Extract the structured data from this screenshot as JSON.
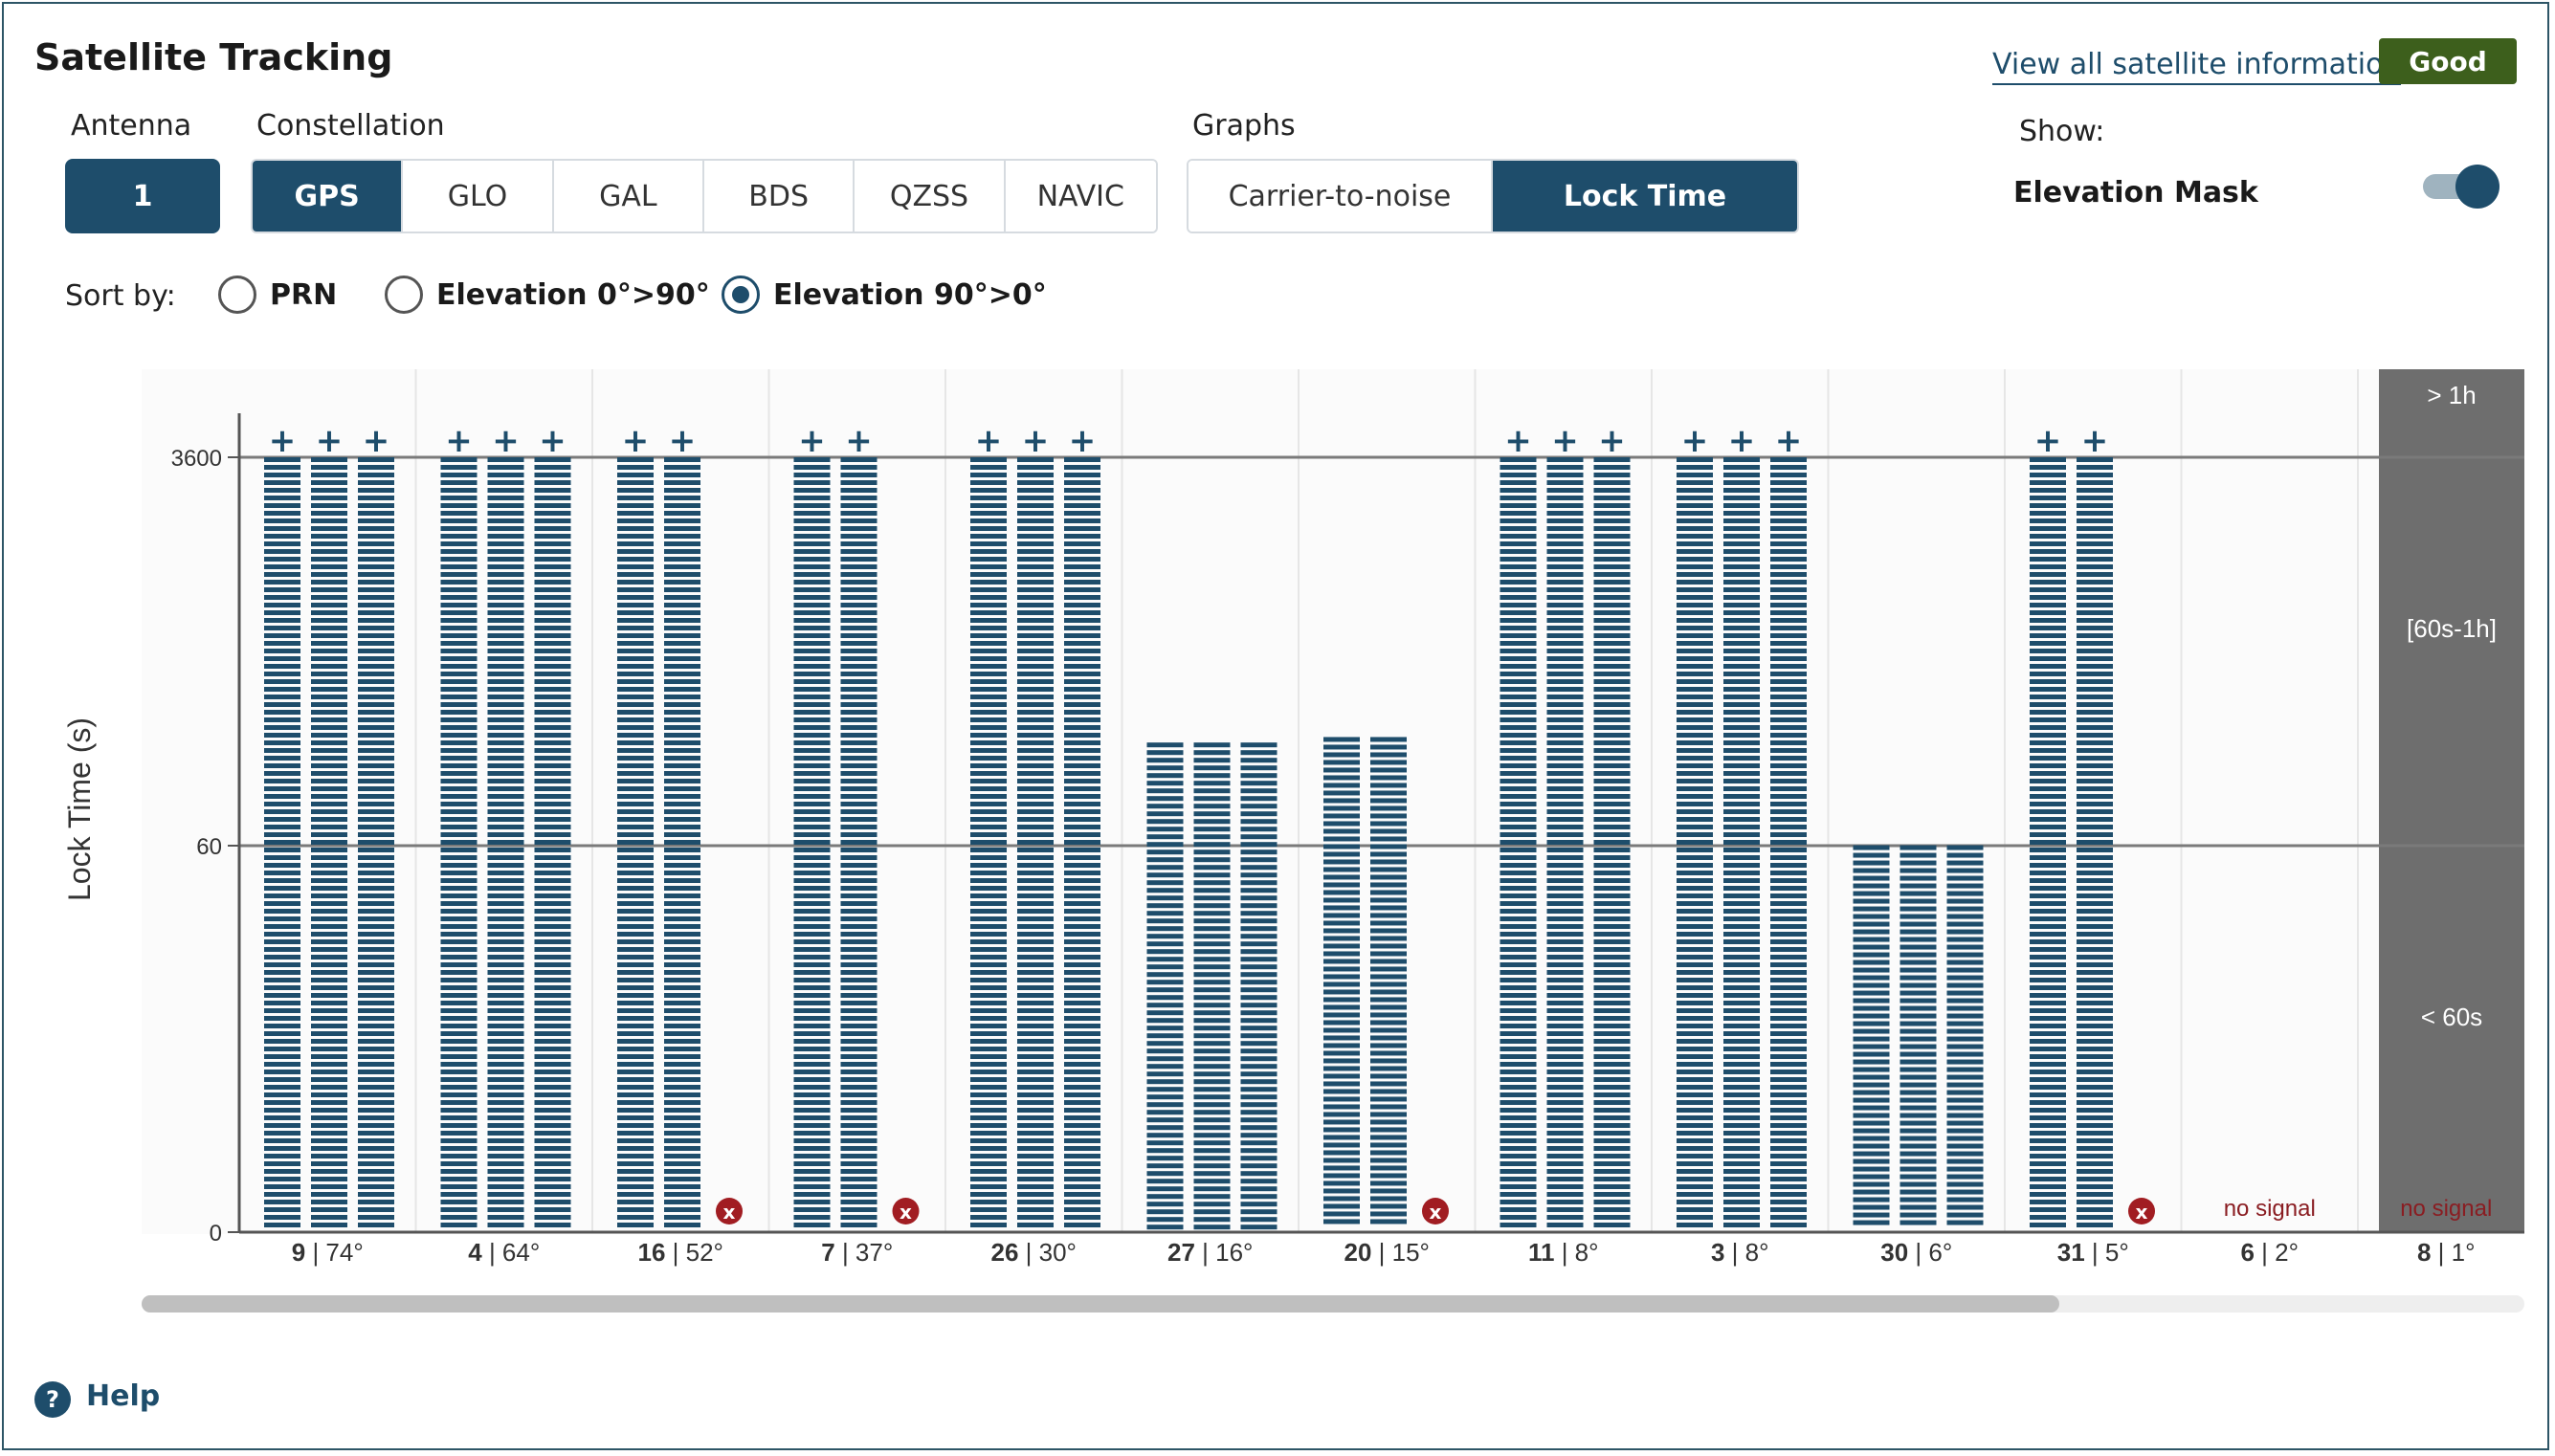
{
  "header": {
    "title": "Satellite Tracking",
    "view_all_link": "View all satellite information",
    "status": "Good",
    "status_color": "#3d5f1c"
  },
  "controls": {
    "antenna_label": "Antenna",
    "antenna_value": "1",
    "constellation_label": "Constellation",
    "constellations": [
      "GPS",
      "GLO",
      "GAL",
      "BDS",
      "QZSS",
      "NAVIC"
    ],
    "constellation_selected": "GPS",
    "graphs_label": "Graphs",
    "graphs": [
      "Carrier-to-noise",
      "Lock Time"
    ],
    "graph_selected": "Lock Time",
    "show_label": "Show:",
    "elevation_mask_label": "Elevation Mask",
    "elevation_mask_on": true,
    "sort_label": "Sort by:",
    "sort_options": [
      "PRN",
      "Elevation 0°>90°",
      "Elevation 90°>0°"
    ],
    "sort_selected": "Elevation 90°>0°"
  },
  "accent_color": "#1e4d6b",
  "chart_data": {
    "type": "bar",
    "ylabel": "Lock Time (s)",
    "y_ticks": [
      "0",
      "60",
      "3600"
    ],
    "y_scale": "piecewise: 0–60 s lower band, 60–3600 s middle band, >3600 s capped with +",
    "bars_per_satellite": 3,
    "satellites": [
      {
        "prn": "9",
        "elev": "74°",
        "locks": [
          3600,
          3600,
          3600
        ],
        "over_1h": [
          true,
          true,
          true
        ],
        "lost": false,
        "no_signal": false
      },
      {
        "prn": "4",
        "elev": "64°",
        "locks": [
          3600,
          3600,
          3600
        ],
        "over_1h": [
          true,
          true,
          true
        ],
        "lost": false,
        "no_signal": false
      },
      {
        "prn": "16",
        "elev": "52°",
        "locks": [
          3600,
          3600,
          0
        ],
        "over_1h": [
          true,
          true,
          false
        ],
        "lost": true,
        "no_signal": false
      },
      {
        "prn": "7",
        "elev": "37°",
        "locks": [
          3600,
          3600,
          0
        ],
        "over_1h": [
          true,
          true,
          false
        ],
        "lost": true,
        "no_signal": false
      },
      {
        "prn": "26",
        "elev": "30°",
        "locks": [
          3600,
          3600,
          3600
        ],
        "over_1h": [
          true,
          true,
          true
        ],
        "lost": false,
        "no_signal": false
      },
      {
        "prn": "27",
        "elev": "16°",
        "locks": [
          1000,
          1000,
          1000
        ],
        "over_1h": [
          false,
          false,
          false
        ],
        "lost": false,
        "no_signal": false
      },
      {
        "prn": "20",
        "elev": "15°",
        "locks": [
          1050,
          1050,
          0
        ],
        "over_1h": [
          false,
          false,
          false
        ],
        "lost": true,
        "no_signal": false
      },
      {
        "prn": "11",
        "elev": "8°",
        "locks": [
          3600,
          3600,
          3600
        ],
        "over_1h": [
          true,
          true,
          true
        ],
        "lost": false,
        "no_signal": false
      },
      {
        "prn": "3",
        "elev": "8°",
        "locks": [
          3600,
          3600,
          3600
        ],
        "over_1h": [
          true,
          true,
          true
        ],
        "lost": false,
        "no_signal": false
      },
      {
        "prn": "30",
        "elev": "6°",
        "locks": [
          64,
          64,
          64
        ],
        "over_1h": [
          false,
          false,
          false
        ],
        "lost": false,
        "no_signal": false
      },
      {
        "prn": "31",
        "elev": "5°",
        "locks": [
          3600,
          3600,
          0
        ],
        "over_1h": [
          true,
          true,
          false
        ],
        "lost": true,
        "no_signal": false
      },
      {
        "prn": "6",
        "elev": "2°",
        "locks": [
          0,
          0,
          0
        ],
        "over_1h": [
          false,
          false,
          false
        ],
        "lost": false,
        "no_signal": true
      },
      {
        "prn": "8",
        "elev": "1°",
        "locks": [
          0,
          0,
          0
        ],
        "over_1h": [
          false,
          false,
          false
        ],
        "lost": false,
        "no_signal": true
      }
    ],
    "no_signal_text": "no signal",
    "lost_marker": "x",
    "over_marker": "+",
    "legend_bands": [
      "> 1h",
      "[60s-1h]",
      "< 60s"
    ],
    "legend_band_color": "#6e6e6e",
    "bar_color": "#1e4d6b",
    "lost_color": "#a11d22",
    "no_signal_color": "#8a1d22",
    "grid": true
  },
  "footer": {
    "help_icon": "?",
    "help_label": "Help"
  }
}
